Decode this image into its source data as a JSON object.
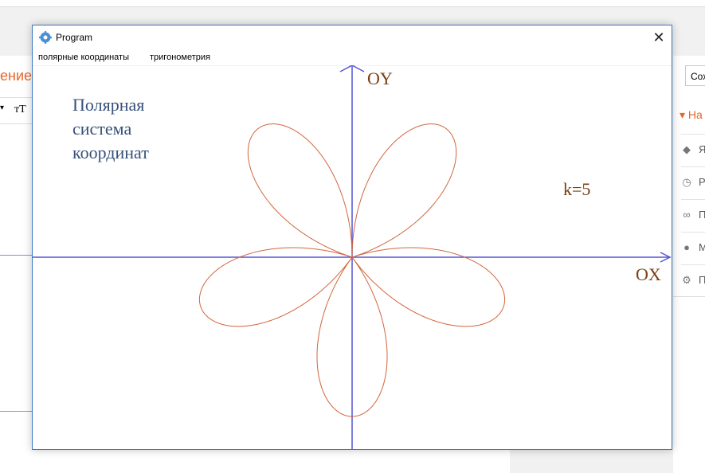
{
  "window": {
    "title": "Program",
    "close_glyph": "✕"
  },
  "menu": {
    "items": [
      "полярные координаты",
      "тригонометрия"
    ]
  },
  "canvas": {
    "title": "Полярная система координат",
    "k_label": "k=5",
    "x_axis_label": "OX",
    "y_axis_label": "OY",
    "curve_color": "#d2643c",
    "axis_color": "#5555d8"
  },
  "background_app": {
    "title_fragment": "ение",
    "save_fragment": "Сох",
    "panel_head_fragment": "На",
    "toolbar_text": "тТ",
    "icons": [
      "tag-icon",
      "clock-icon",
      "link-icon",
      "location-pin-icon",
      "gear-icon"
    ],
    "item_fragments": [
      "Я",
      "Р",
      "П",
      "М",
      "П"
    ]
  }
}
